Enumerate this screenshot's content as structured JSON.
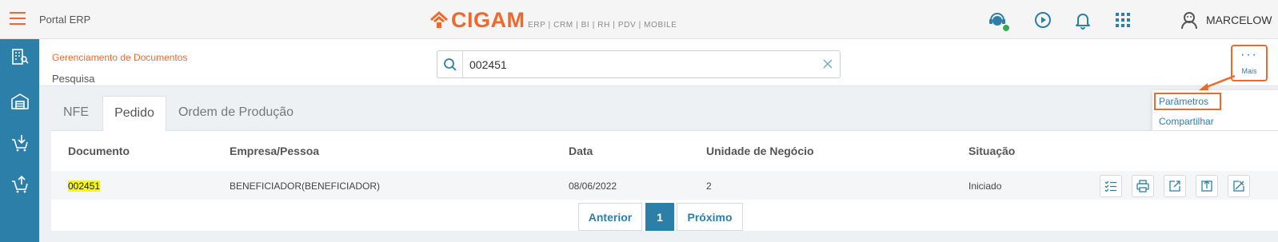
{
  "app": {
    "title": "Portal ERP",
    "logo_text": "CIGAM",
    "logo_subtitle": "ERP | CRM | BI | RH | PDV | MOBILE",
    "user_name": "MARCELOW"
  },
  "colors": {
    "accent": "#f0692c",
    "primary": "#2c7fa8",
    "highlight": "#f5f51e",
    "online": "#2fae4e"
  },
  "topbar_icons": [
    "menu-icon",
    "support-agent-icon",
    "play-circle-icon",
    "bell-icon",
    "apps-grid-icon",
    "user-avatar-icon"
  ],
  "sidebar_icons": [
    "building-search-icon",
    "warehouse-icon",
    "cart-download-icon",
    "cart-upload-icon"
  ],
  "header": {
    "breadcrumb": "Gerenciamento de Documentos",
    "subtitle": "Pesquisa"
  },
  "search": {
    "value": "002451",
    "placeholder": ""
  },
  "more_button": {
    "dots": "···",
    "label": "Mais"
  },
  "more_menu": {
    "items": [
      "Parâmetros",
      "Compartilhar"
    ]
  },
  "tabs": [
    "NFE",
    "Pedido",
    "Ordem de Produção"
  ],
  "active_tab": "Pedido",
  "table": {
    "columns": [
      "Documento",
      "Empresa/Pessoa",
      "Data",
      "Unidade de Negócio",
      "Situação"
    ],
    "rows": [
      {
        "documento": "002451",
        "empresa": "BENEFICIADOR(BENEFICIADOR)",
        "data": "08/06/2022",
        "unidade": "2",
        "situacao": "Iniciado"
      }
    ],
    "row_actions": [
      "checklist-icon",
      "printer-icon",
      "edit-export-icon",
      "upload-icon",
      "close-export-icon"
    ]
  },
  "pagination": {
    "prev": "Anterior",
    "current": "1",
    "next": "Próximo"
  }
}
